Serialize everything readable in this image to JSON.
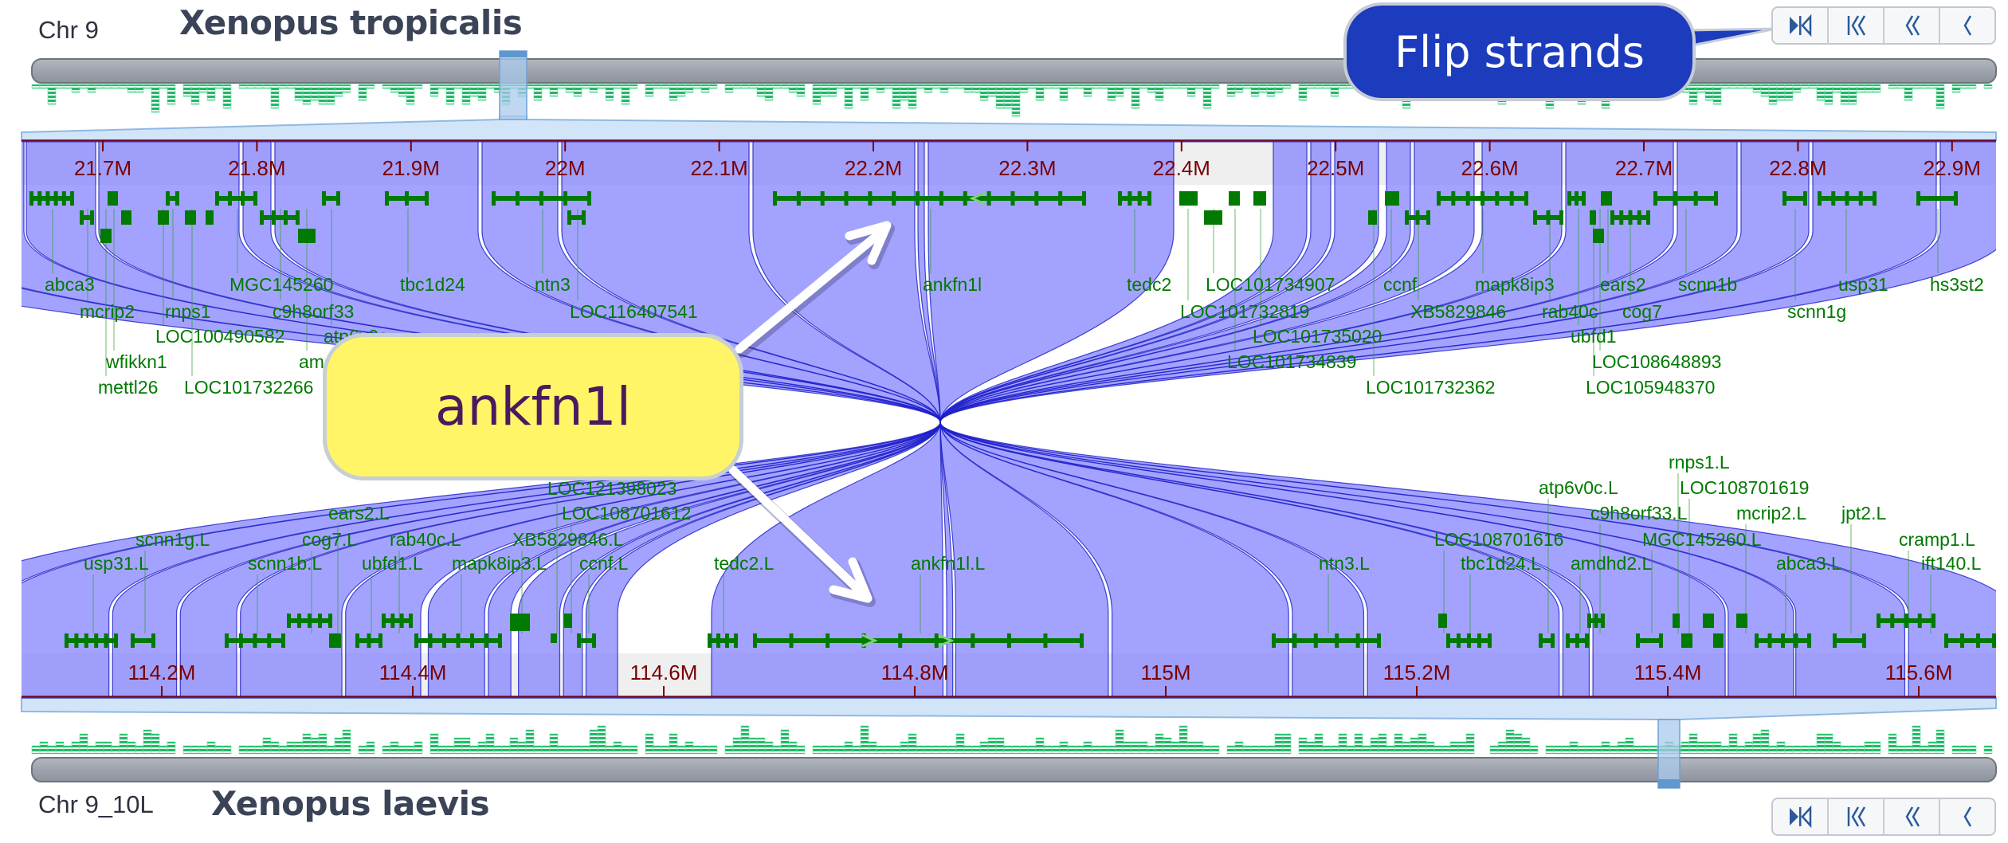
{
  "top_genome": {
    "chromosome": "Chr 9",
    "species": "Xenopus tropicalis"
  },
  "bottom_genome": {
    "chromosome": "Chr 9_10L",
    "species": "Xenopus laevis"
  },
  "top_ticks": [
    "21.7M",
    "21.8M",
    "21.9M",
    "22M",
    "22.1M",
    "22.2M",
    "22.3M",
    "22.4M",
    "22.5M",
    "22.6M",
    "22.7M",
    "22.8M",
    "22.9M"
  ],
  "bottom_ticks": [
    "114.2M",
    "114.4M",
    "114.6M",
    "114.8M",
    "115M",
    "115.2M",
    "115.4M",
    "115.6M"
  ],
  "top_genes": [
    "abca3",
    "MGC145260",
    "tbc1d24",
    "ntn3",
    "ankfn1l",
    "tedc2",
    "LOC101734907",
    "ccnf",
    "mapk8ip3",
    "ears2",
    "scnn1b",
    "usp31",
    "hs3st2",
    "mcrip2",
    "rnps1",
    "c9h8orf33",
    "LOC116407541",
    "LOC101732819",
    "XB5829846",
    "rab40c",
    "cog7",
    "scnn1g",
    "LOC100490582",
    "atp6v0c",
    "LOC101735020",
    "ubfd1",
    "wfikkn1",
    "amdhd2",
    "LOC101734839",
    "LOC108648893",
    "mettl26",
    "LOC101732266",
    "LOC101732362",
    "LOC105948370"
  ],
  "bottom_genes": [
    "LOC121398023",
    "LOC108701612",
    "ears2.L",
    "scnn1g.L",
    "cog7.L",
    "rab40c.L",
    "XB5829846.L",
    "usp31.L",
    "scnn1b.L",
    "ubfd1.L",
    "mapk8ip3.L",
    "ccnf.L",
    "tedc2.L",
    "ankfn1l.L",
    "ntn3.L",
    "tbc1d24.L",
    "amdhd2.L",
    "abca3.L",
    "ift140.L",
    "LOC108701616",
    "MGC145260.L",
    "cramp1.L",
    "c9h8orf33.L",
    "mcrip2.L",
    "jpt2.L",
    "atp6v0c.L",
    "LOC108701619",
    "rnps1.L"
  ],
  "nav_buttons": [
    {
      "icon": "flip-strands-icon",
      "tooltip": "Flip strands"
    },
    {
      "icon": "jump-to-start-icon"
    },
    {
      "icon": "fast-back-icon"
    },
    {
      "icon": "back-icon"
    }
  ],
  "tooltip": {
    "label": "Flip strands"
  },
  "highlight": {
    "gene": "ankfn1l"
  },
  "colors": {
    "ribbon": "#8080ff",
    "gene": "#007a00",
    "tick": "#7a0000",
    "callout": "#1c3bbd",
    "highlight": "#fff566"
  }
}
